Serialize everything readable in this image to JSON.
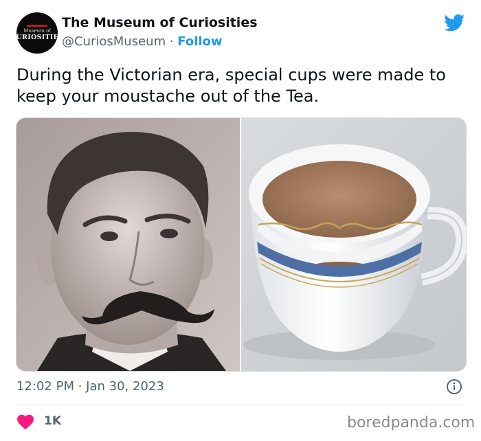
{
  "header": {
    "avatar_line1": "Museum of",
    "avatar_line2": "CURIOSITIES",
    "display_name": "The Museum of Curiosities",
    "handle": "@CuriosMuseum",
    "separator": " · ",
    "follow_label": "Follow"
  },
  "tweet": {
    "text": "During the Victorian era, special cups were made to keep your moustache out of the Tea."
  },
  "meta": {
    "timestamp": "12:02 PM · Jan 30, 2023"
  },
  "engagement": {
    "likes": "1K"
  },
  "watermark": "boredpanda.com",
  "colors": {
    "twitter_blue": "#1d9bf0",
    "like_red": "#f91880",
    "text_secondary": "#536471"
  },
  "icons": [
    "twitter-bird-icon",
    "info-icon",
    "heart-icon"
  ]
}
